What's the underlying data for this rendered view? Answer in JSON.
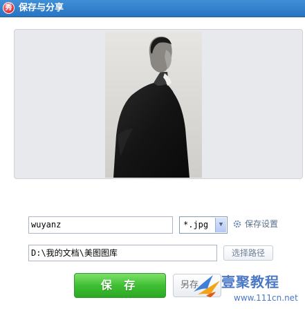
{
  "window": {
    "title": "保存与分享",
    "icon": "app-logo-icon",
    "icon_glyph": "秀"
  },
  "preview": {
    "image": "photo-preview"
  },
  "file": {
    "name": "wuyanz",
    "format": "*.jpg",
    "path": "D:\\我的文档\\美图图库"
  },
  "actions": {
    "save_settings": "保存设置",
    "choose_path": "选择路径",
    "save": "保 存",
    "save_as": "另存"
  },
  "watermark": {
    "title": "壹聚教程",
    "url": "www.111cn.net"
  },
  "colors": {
    "titlebar": "#2a74c2",
    "save_button": "#3fbf34",
    "watermark": "#4a78c6"
  }
}
